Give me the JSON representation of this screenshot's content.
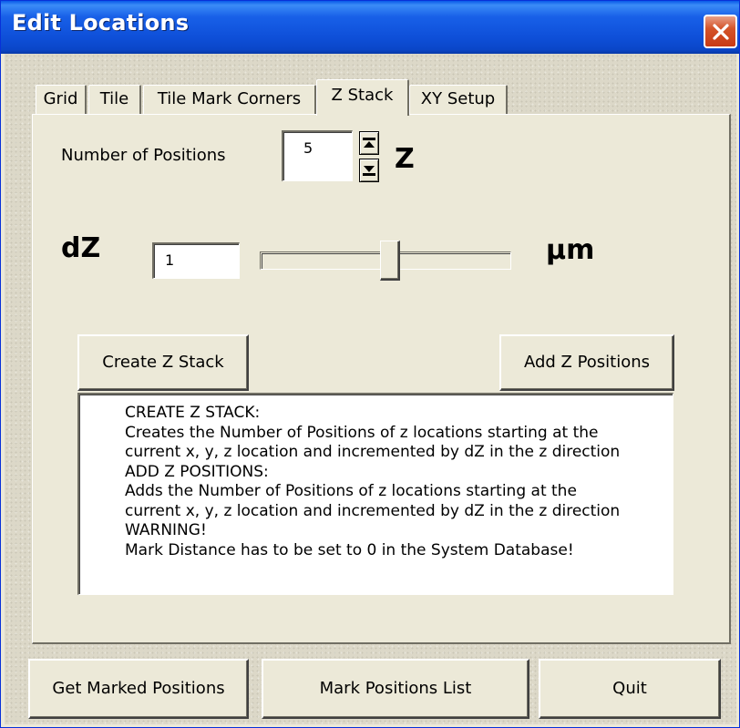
{
  "window": {
    "title": "Edit Locations"
  },
  "tabs": [
    {
      "label": "Grid",
      "active": false
    },
    {
      "label": "Tile",
      "active": false
    },
    {
      "label": "Tile Mark Corners",
      "active": false
    },
    {
      "label": "Z Stack",
      "active": true
    },
    {
      "label": "XY Setup",
      "active": false
    }
  ],
  "zstack": {
    "num_positions_label": "Number of Positions",
    "num_positions_value": "5",
    "z_label": "Z",
    "dz_label": "dZ",
    "dz_value": "1",
    "unit_label": "µm",
    "slider_fraction": 0.52,
    "create_button": "Create Z Stack",
    "add_button": "Add Z Positions",
    "description_lines": [
      "CREATE Z STACK:",
      "Creates the Number of Positions of z locations starting at the",
      "current x, y, z location and incremented by dZ in the z direction",
      "ADD Z POSITIONS:",
      "Adds the Number of Positions of z locations starting at the",
      "current x, y, z location and incremented by dZ in the z direction",
      "WARNING!",
      "Mark Distance has to be set to 0 in the System Database!"
    ]
  },
  "footer": {
    "get_marked": "Get Marked Positions",
    "mark_list": "Mark Positions List",
    "quit": "Quit"
  },
  "colors": {
    "titlebar": "#0a46c8",
    "face": "#ece9d8",
    "close": "#c83a14"
  },
  "icons": [
    "close-icon",
    "spin-up-icon",
    "spin-down-icon"
  ]
}
